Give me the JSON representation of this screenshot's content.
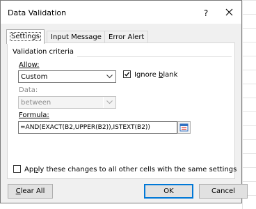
{
  "window": {
    "title": "Data Validation",
    "help_glyph": "?",
    "close_glyph": "close"
  },
  "tabs": [
    {
      "label": "Settings",
      "active": true
    },
    {
      "label": "Input Message",
      "active": false
    },
    {
      "label": "Error Alert",
      "active": false
    }
  ],
  "settings": {
    "section_label": "Validation criteria",
    "allow_label": "Allow:",
    "allow_value": "Custom",
    "ignore_blank_label_pre": "Ignore ",
    "ignore_blank_label_key": "b",
    "ignore_blank_label_post": "lank",
    "ignore_blank_checked": true,
    "data_label": "Data:",
    "data_value": "between",
    "data_enabled": false,
    "formula_label": "Formula:",
    "formula_value": "=AND(EXACT(B2,UPPER(B2)),ISTEXT(B2))",
    "apply_all_pre": "Ap",
    "apply_all_key": "p",
    "apply_all_post": "ly these changes to all other cells with the same settings",
    "apply_all_checked": false
  },
  "buttons": {
    "clear_all_key": "C",
    "clear_all_rest": "lear All",
    "ok": "OK",
    "cancel": "Cancel"
  },
  "colors": {
    "dialog_bg": "#f0f0f0",
    "default_button_border": "#0078d7",
    "collapse_icon_red": "#d9403a",
    "collapse_icon_blue": "#2f6fc0"
  }
}
